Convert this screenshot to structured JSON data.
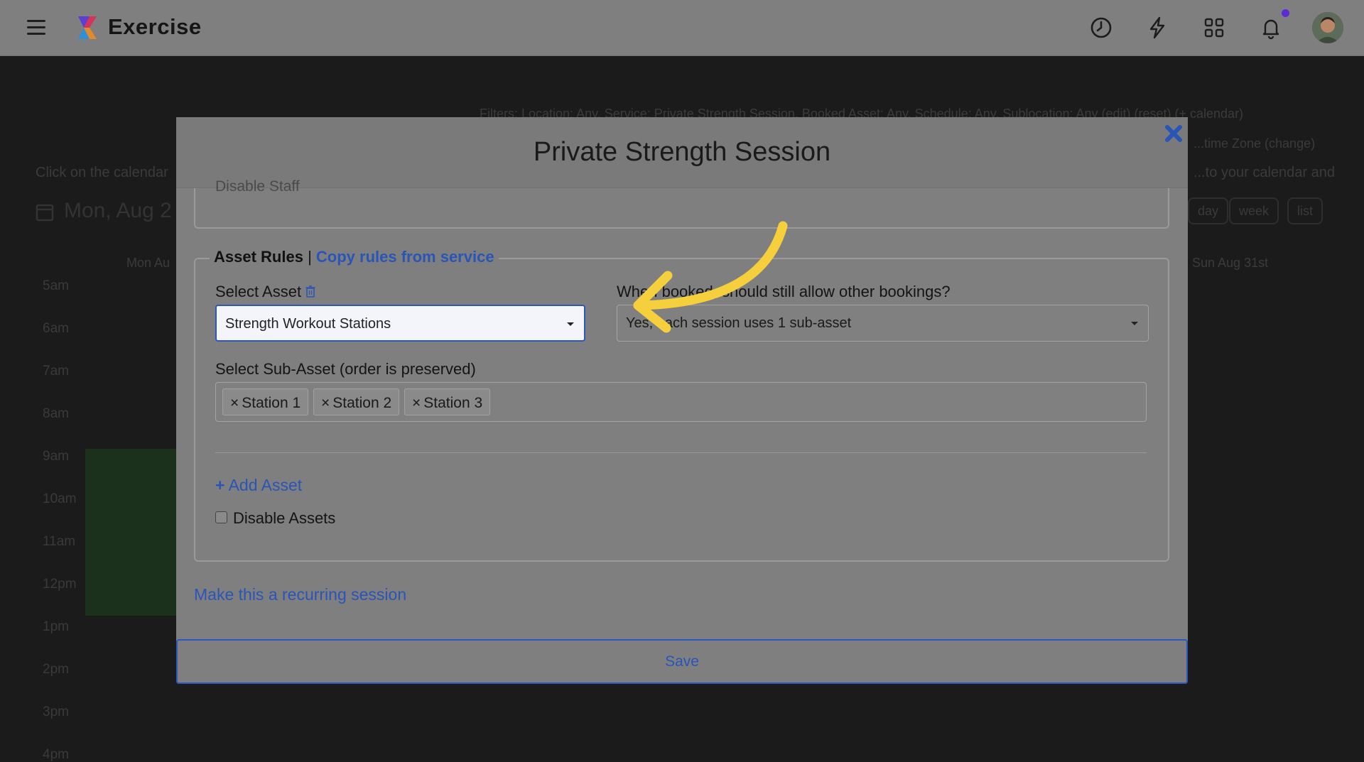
{
  "app": {
    "title": "Exercise",
    "topbar_icons": [
      "clock-icon",
      "bolt-icon",
      "apps-grid-icon",
      "bell-icon"
    ]
  },
  "background": {
    "filters_text": "Filters: Location: Any, Service: Private Strength Session, Booked Asset: Any, Schedule: Any, Sublocation: Any (edit) (reset) (+ calendar)",
    "timezone_text": "...time Zone (change)",
    "instruction_left": "Click on the calendar",
    "instruction_right": "...to your calendar and",
    "date_heading": "Mon, Aug 2",
    "view_buttons": [
      "day",
      "week",
      "list"
    ],
    "col_left": "Mon Au",
    "col_right": "Sun Aug 31st",
    "times": [
      "5am",
      "6am",
      "7am",
      "8am",
      "9am",
      "10am",
      "11am",
      "12pm",
      "1pm",
      "2pm",
      "3pm",
      "4pm"
    ]
  },
  "modal": {
    "title": "Private Strength Session",
    "prev_section_label": "Disable Staff",
    "asset_rules": {
      "legend_bold": "Asset Rules",
      "separator": " | ",
      "copy_link": "Copy rules from service",
      "select_asset_label": "Select Asset",
      "select_asset_value": "Strength Workout Stations",
      "allow_bookings_label": "When booked, should still allow other bookings?",
      "allow_bookings_value": "Yes, each session uses 1 sub-asset",
      "sub_asset_label": "Select Sub-Asset (order is preserved)",
      "sub_assets": [
        "Station 1",
        "Station 2",
        "Station 3"
      ],
      "tag_remove": "×",
      "add_asset": "Add Asset",
      "add_asset_plus": "+",
      "disable_assets": "Disable Assets"
    },
    "recurring_link": "Make this a recurring session",
    "save_label": "Save"
  },
  "colors": {
    "highlight": "#f5cf3c",
    "link": "#2a55b8",
    "notification_dot": "#5b2bd6"
  }
}
